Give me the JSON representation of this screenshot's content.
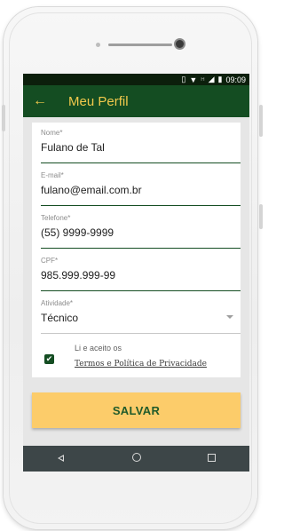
{
  "status_bar": {
    "time": "09:09",
    "icons": [
      "vibrate-icon",
      "wifi-icon",
      "signal-h-icon",
      "signal-icon",
      "battery-icon"
    ],
    "network_label": "H"
  },
  "app_bar": {
    "back_icon": "arrow-left-icon",
    "title": "Meu Perfil",
    "accent_color": "#f2c94c",
    "background": "#144d22"
  },
  "form": {
    "fields": [
      {
        "label": "Nome*",
        "value": "Fulano de Tal"
      },
      {
        "label": "E-mail*",
        "value": "fulano@email.com.br"
      },
      {
        "label": "Telefone*",
        "value": "(55) 9999-9999"
      },
      {
        "label": "CPF*",
        "value": "985.999.999-99"
      },
      {
        "label": "Atividade*",
        "value": "Técnico"
      }
    ],
    "terms": {
      "checked": true,
      "line1": "Li e aceito os",
      "link": "Termos e Política de Privacidade"
    }
  },
  "save_button": {
    "label": "SALVAR",
    "color": "#fccc6a"
  },
  "nav_bar": {
    "icons": [
      "back-nav-icon",
      "home-nav-icon",
      "recents-nav-icon"
    ]
  }
}
